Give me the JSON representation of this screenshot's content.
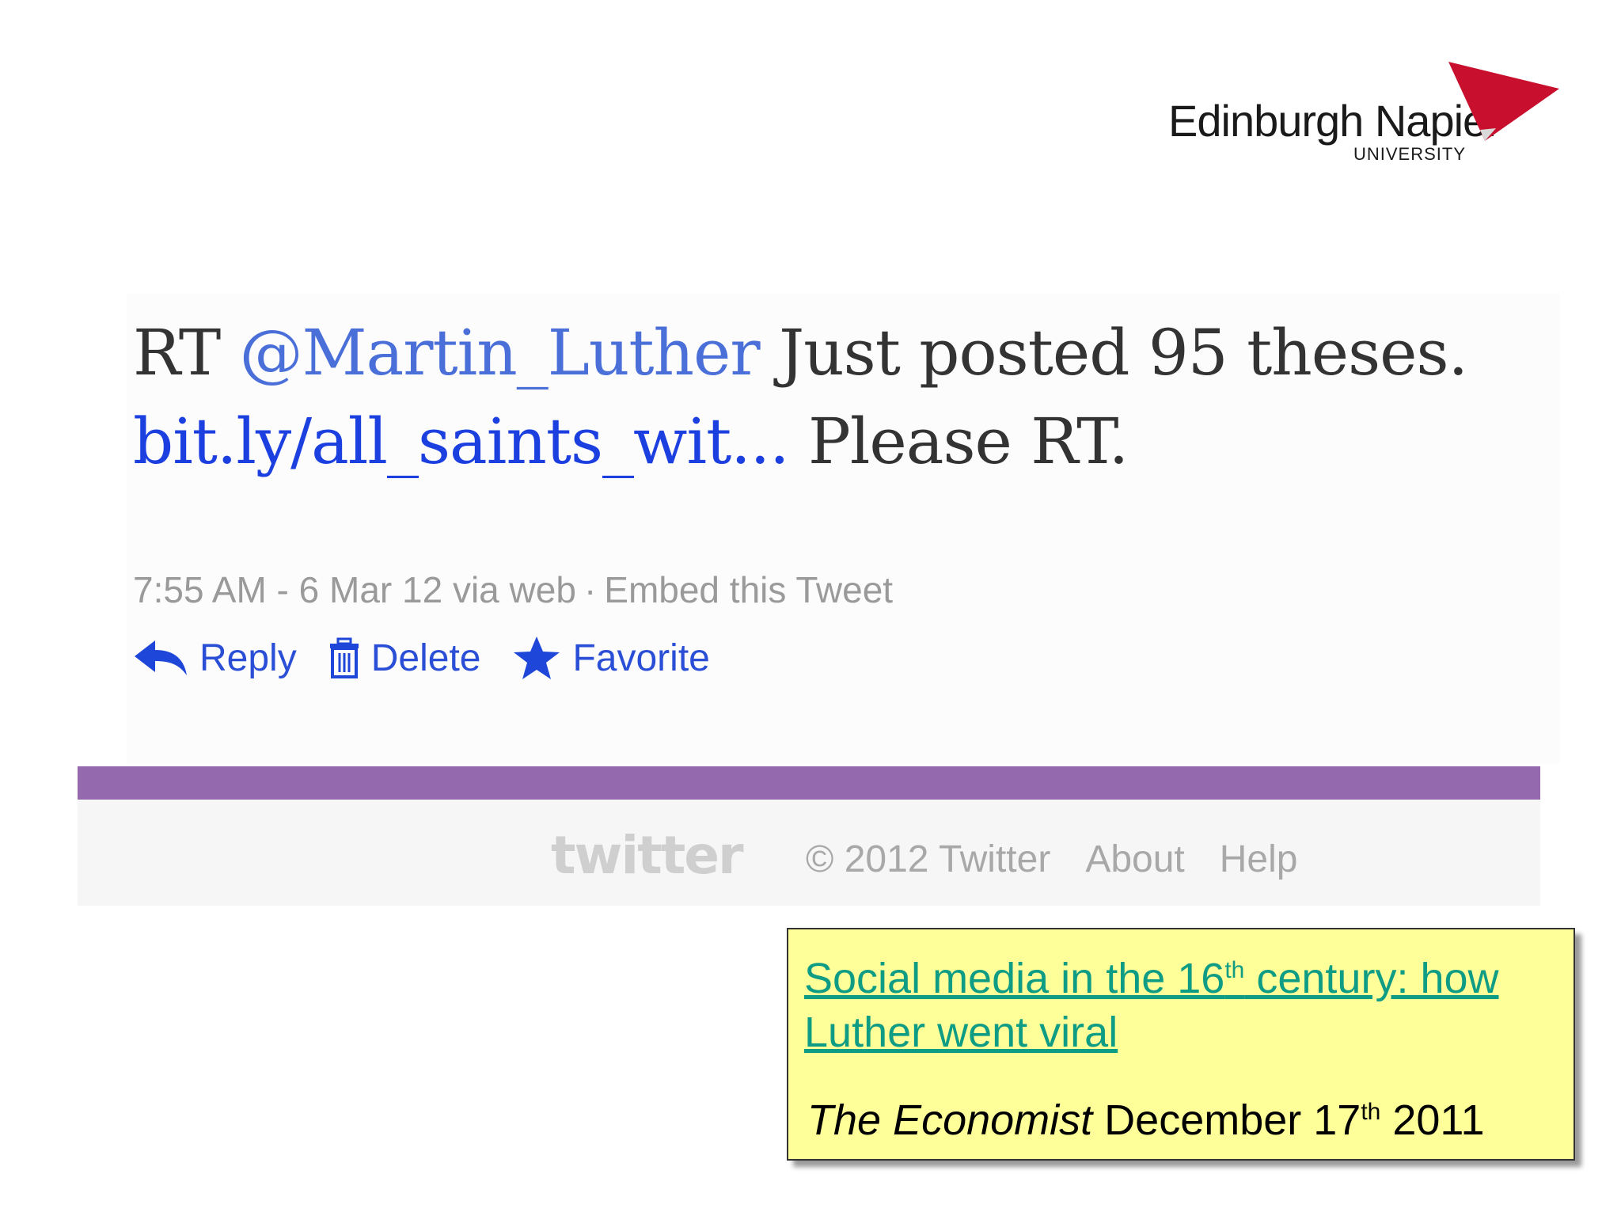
{
  "logo": {
    "name": "Edinburgh Napier",
    "subtitle": "UNIVERSITY",
    "color": "#c8102e"
  },
  "tweet": {
    "rt": "RT",
    "mention": "@Martin_Luther",
    "text_a": "Just posted 95 theses.",
    "link": "bit.ly/all_saints_wit...",
    "text_b": "Please RT.",
    "timestamp": "7:55 AM - 6 Mar 12 via web",
    "separator": "·",
    "embed": "Embed this Tweet",
    "actions": [
      {
        "label": "Reply",
        "icon": "reply-arrow-icon"
      },
      {
        "label": "Delete",
        "icon": "trash-icon"
      },
      {
        "label": "Favorite",
        "icon": "star-icon"
      }
    ]
  },
  "footer": {
    "logo": "twitter",
    "copyright": "© 2012 Twitter",
    "links": [
      "About",
      "Help"
    ]
  },
  "note": {
    "link_part1": "Social media in the 16",
    "link_sup": "th",
    "link_part2": " century: how Luther went viral",
    "source_title": "The Economist",
    "source_date_a": " December 17",
    "source_sup": "th",
    "source_date_b": " 2011"
  }
}
